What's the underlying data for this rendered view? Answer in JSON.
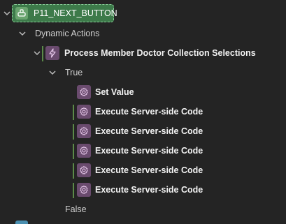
{
  "tree": {
    "button_node": {
      "label": "P11_NEXT_BUTTON"
    },
    "dynamic_actions": {
      "label": "Dynamic Actions"
    },
    "action": {
      "label": "Process Member Doctor Collection Selections"
    },
    "true_branch": {
      "label": "True"
    },
    "true_items": [
      {
        "label": "Set Value"
      },
      {
        "label": "Execute Server-side Code"
      },
      {
        "label": "Execute Server-side Code"
      },
      {
        "label": "Execute Server-side Code"
      },
      {
        "label": "Execute Server-side Code"
      },
      {
        "label": "Execute Server-side Code"
      }
    ],
    "false_branch": {
      "label": "False"
    }
  },
  "colors": {
    "background": "#242424",
    "selected_node": "#3d7a4a",
    "action_icon": "#6a4b6e",
    "guide_line": "#5b8a48"
  }
}
